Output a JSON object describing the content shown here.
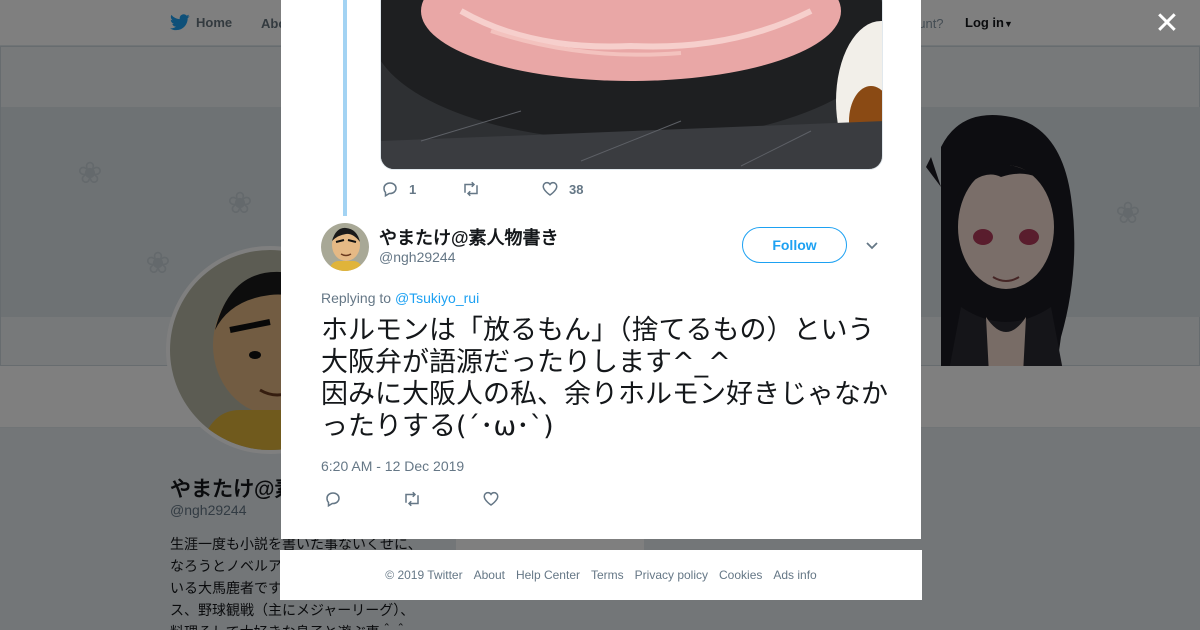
{
  "colors": {
    "accent": "#1da1f2",
    "thread_line": "#a3d3f3",
    "text": "#14171a",
    "muted": "#657786"
  },
  "topnav": {
    "home_label": "Home",
    "about_label": "Abo",
    "account_prompt": "ccount?",
    "login_label": "Log in"
  },
  "background_profile": {
    "name": "やまたけ@素",
    "handle": "@ngh29244",
    "bio": "生涯一度も小説を書いた事ないくせに、なろうとノベルア…いる大馬鹿者です…ス、野球観戦（主にメジャーリーグ）、料理そして大好きな息子と遊ぶ事＾＾",
    "bio_lines": [
      "生涯一度も小説を書いた事ないくせに、",
      "なろうとノベルア",
      "いる大馬鹿者です",
      "ス、野球観戦（主にメジャーリーグ）、",
      "料理そして大好きな息子と遊ぶ事＾＾"
    ]
  },
  "previous_tweet": {
    "reply_count": "1",
    "retweet_count": "",
    "like_count": "38"
  },
  "tweet": {
    "author_name": "やまたけ@素人物書き",
    "author_handle": "@ngh29244",
    "follow_label": "Follow",
    "replying_prefix": "Replying to ",
    "replying_to": "@Tsukiyo_rui",
    "text": "ホルモンは「放るもん」（捨てるもの）という大阪弁が語源だったりします^_^\n因みに大阪人の私、余りホルモン好きじゃなかったりする(´･ω･`)",
    "timestamp": "6:20 AM - 12 Dec 2019"
  },
  "footer": {
    "links": [
      "© 2019 Twitter",
      "About",
      "Help Center",
      "Terms",
      "Privacy policy",
      "Cookies",
      "Ads info"
    ]
  },
  "icons": [
    "twitter-bird-icon",
    "caret-down-icon",
    "close-icon",
    "reply-icon",
    "retweet-icon",
    "like-icon",
    "chevron-down-icon"
  ]
}
